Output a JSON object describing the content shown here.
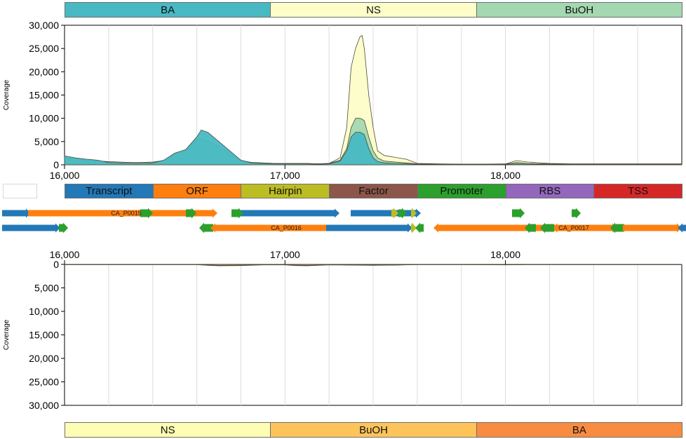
{
  "top_legend": [
    {
      "label": "BA",
      "color": "#48b9c3"
    },
    {
      "label": "NS",
      "color": "#fdfdc9"
    },
    {
      "label": "BuOH",
      "color": "#a4d8b0"
    }
  ],
  "bottom_legend": [
    {
      "label": "NS",
      "color": "#fdfdb3"
    },
    {
      "label": "BuOH",
      "color": "#fec45a"
    },
    {
      "label": "BA",
      "color": "#f98c40"
    }
  ],
  "feature_legend": [
    {
      "label": "Transcript",
      "color": "#2378b7"
    },
    {
      "label": "ORF",
      "color": "#ff7f0e"
    },
    {
      "label": "Hairpin",
      "color": "#bcbd22"
    },
    {
      "label": "Factor",
      "color": "#8c564b"
    },
    {
      "label": "Promoter",
      "color": "#2ca02c"
    },
    {
      "label": "RBS",
      "color": "#9467bd"
    },
    {
      "label": "TSS",
      "color": "#d62728"
    }
  ],
  "axis": {
    "ylabel": "Coverage",
    "x_ticks": [
      "16,000",
      "17,000",
      "18,000"
    ]
  },
  "feature_labels": [
    "CA_P0015",
    "CA_P0016",
    "CA_P0017"
  ],
  "chart_data": [
    {
      "type": "area",
      "ylabel": "Coverage",
      "xlim": [
        16000,
        18800
      ],
      "ylim": [
        0,
        30000
      ],
      "x_ticks": [
        16000,
        17000,
        18000
      ],
      "y_ticks": [
        0,
        5000,
        10000,
        15000,
        20000,
        25000,
        30000
      ],
      "y_tick_labels": [
        "0",
        "5,000",
        "10,000",
        "15,000",
        "20,000",
        "25,000",
        "30,000"
      ],
      "grid": true,
      "x": [
        16000,
        16050,
        16100,
        16150,
        16200,
        16250,
        16300,
        16350,
        16400,
        16450,
        16500,
        16550,
        16600,
        16620,
        16650,
        16700,
        16750,
        16800,
        16850,
        16900,
        16950,
        17000,
        17050,
        17100,
        17150,
        17200,
        17250,
        17280,
        17300,
        17320,
        17340,
        17350,
        17360,
        17380,
        17400,
        17420,
        17450,
        17500,
        17550,
        17600,
        17700,
        17800,
        17900,
        18000,
        18050,
        18100,
        18200,
        18300,
        18400,
        18500,
        18600,
        18700,
        18800
      ],
      "series": [
        {
          "name": "NS",
          "color": "#fdfdc9",
          "values": [
            800,
            700,
            600,
            500,
            400,
            300,
            200,
            200,
            300,
            500,
            800,
            1200,
            1500,
            1500,
            1200,
            1000,
            800,
            500,
            300,
            300,
            200,
            200,
            200,
            200,
            200,
            300,
            1500,
            8000,
            21000,
            25000,
            27500,
            27800,
            25000,
            15000,
            8000,
            3000,
            2000,
            1600,
            1200,
            300,
            200,
            150,
            150,
            200,
            900,
            600,
            300,
            200,
            200,
            200,
            200,
            200,
            200
          ]
        },
        {
          "name": "BuOH",
          "color": "#a4d8b0",
          "values": [
            1500,
            1400,
            1000,
            800,
            700,
            600,
            500,
            500,
            600,
            900,
            2300,
            3000,
            5500,
            5500,
            5000,
            4000,
            2500,
            900,
            500,
            400,
            300,
            300,
            300,
            300,
            200,
            300,
            1000,
            3500,
            8000,
            10000,
            10000,
            9800,
            9500,
            6000,
            3000,
            1500,
            800,
            600,
            400,
            200,
            150,
            100,
            100,
            150,
            500,
            300,
            200,
            150,
            150,
            150,
            150,
            150,
            150
          ]
        },
        {
          "name": "BA",
          "color": "#48b9c3",
          "values": [
            1900,
            1500,
            1200,
            1000,
            500,
            400,
            300,
            300,
            400,
            1000,
            2500,
            3300,
            6000,
            7500,
            7000,
            5000,
            3000,
            1000,
            400,
            300,
            200,
            200,
            200,
            200,
            100,
            200,
            800,
            3000,
            6000,
            7000,
            7000,
            6800,
            6500,
            3500,
            1500,
            700,
            400,
            300,
            200,
            100,
            100,
            100,
            100,
            100,
            200,
            150,
            100,
            100,
            100,
            100,
            100,
            100,
            100
          ]
        }
      ]
    },
    {
      "type": "area",
      "ylabel": "Coverage",
      "xlim": [
        16000,
        18800
      ],
      "ylim": [
        0,
        30000
      ],
      "y_inverted": true,
      "x_ticks": [
        16000,
        17000,
        18000
      ],
      "y_ticks": [
        0,
        5000,
        10000,
        15000,
        20000,
        25000,
        30000
      ],
      "y_tick_labels": [
        "0",
        "5,000",
        "10,000",
        "15,000",
        "20,000",
        "25,000",
        "30,000"
      ],
      "grid": true,
      "x": [
        16000,
        16200,
        16400,
        16600,
        16650,
        16700,
        16800,
        16900,
        17000,
        17050,
        17100,
        17200,
        17300,
        17400,
        17500,
        17600,
        17800,
        18000,
        18100,
        18300,
        18500,
        18800
      ],
      "series": [
        {
          "name": "NS",
          "color": "#fdfdb3",
          "values": [
            50,
            50,
            50,
            50,
            200,
            300,
            250,
            100,
            100,
            250,
            300,
            100,
            150,
            200,
            150,
            50,
            50,
            100,
            50,
            50,
            50,
            50
          ]
        },
        {
          "name": "BuOH",
          "color": "#fec45a",
          "values": [
            40,
            40,
            40,
            40,
            150,
            250,
            200,
            80,
            80,
            200,
            250,
            80,
            120,
            160,
            120,
            40,
            40,
            80,
            40,
            40,
            40,
            40
          ]
        },
        {
          "name": "BA",
          "color": "#f98c40",
          "values": [
            30,
            30,
            30,
            30,
            100,
            200,
            150,
            60,
            60,
            150,
            200,
            60,
            100,
            120,
            100,
            30,
            30,
            60,
            30,
            30,
            30,
            30
          ]
        }
      ]
    }
  ]
}
